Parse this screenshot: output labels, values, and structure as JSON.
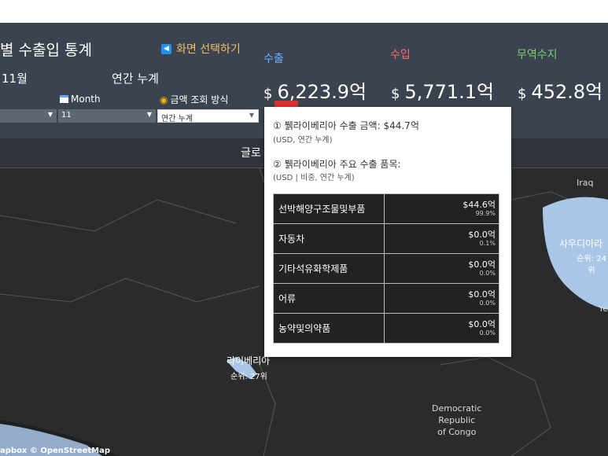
{
  "header": {
    "title": "별 수출입 통계",
    "screen_select": "화면 선택하기",
    "month": "11월",
    "period": "연간 누계",
    "month_label": "Month",
    "method_label": "금액 조회 방식",
    "dropdown1": "",
    "dropdown2": "11",
    "dropdown3": "연간 누계"
  },
  "kpis": {
    "export_label": "수출",
    "import_label": "수입",
    "balance_label": "무역수지",
    "currency": "$",
    "export_value": "6,223.9억",
    "import_value": "5,771.1억",
    "balance_value": "452.8억"
  },
  "tabs": {
    "global": "글로"
  },
  "map": {
    "iraq": "Iraq",
    "saudi_name": "사우디아라",
    "saudi_rank": "순위: 24위",
    "yemen": "Ye",
    "liberia_name": "라이베리아",
    "liberia_rank": "순위: 27위",
    "congo": "Democratic\nRepublic\nof Congo",
    "credit": "apbox © OpenStreetMap",
    "colors": {
      "land": "#2a2b2d",
      "highlight": "#a9c6e6",
      "ocean": "#1f2022"
    }
  },
  "tooltip": {
    "line1": "① 뷁라이베리아 수출 금액: $44.7억",
    "sub1": "(USD,  연간 누계)",
    "line2": "② 뷁라이베리아 주요 수출 품목:",
    "sub2": "(USD | 비중,  연간 누계)",
    "items": [
      {
        "name": "선박해양구조물및부품",
        "value": "$44.6억",
        "pct": "99.9%"
      },
      {
        "name": "자동차",
        "value": "$0.0억",
        "pct": "0.1%"
      },
      {
        "name": "기타석유화학제품",
        "value": "$0.0억",
        "pct": "0.0%"
      },
      {
        "name": "어류",
        "value": "$0.0억",
        "pct": "0.0%"
      },
      {
        "name": "농약및의약품",
        "value": "$0.0억",
        "pct": "0.0%"
      }
    ]
  }
}
